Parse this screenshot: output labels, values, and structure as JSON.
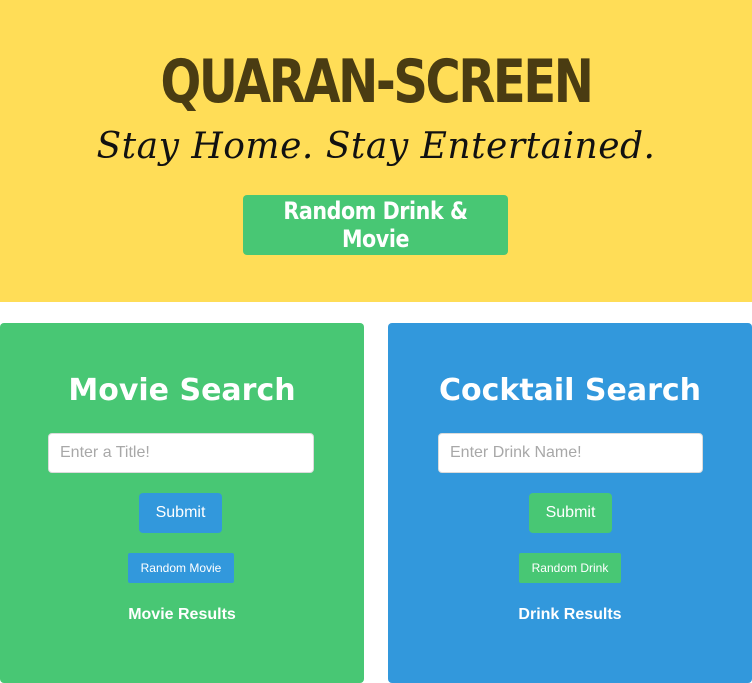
{
  "hero": {
    "title": "QUARAN-SCREEN",
    "subtitle": "Stay Home. Stay Entertained.",
    "random_button_label": "Random Drink & Movie"
  },
  "movie_panel": {
    "title": "Movie Search",
    "input_placeholder": "Enter a Title!",
    "input_value": "",
    "submit_label": "Submit",
    "random_label": "Random Movie",
    "results_label": "Movie Results"
  },
  "drink_panel": {
    "title": "Cocktail Search",
    "input_placeholder": "Enter Drink Name!",
    "input_value": "",
    "submit_label": "Submit",
    "random_label": "Random Drink",
    "results_label": "Drink Results"
  },
  "colors": {
    "hero_background": "#ffdd57",
    "title_color": "#4a3c12",
    "green": "#48c774",
    "blue": "#3298dc"
  }
}
